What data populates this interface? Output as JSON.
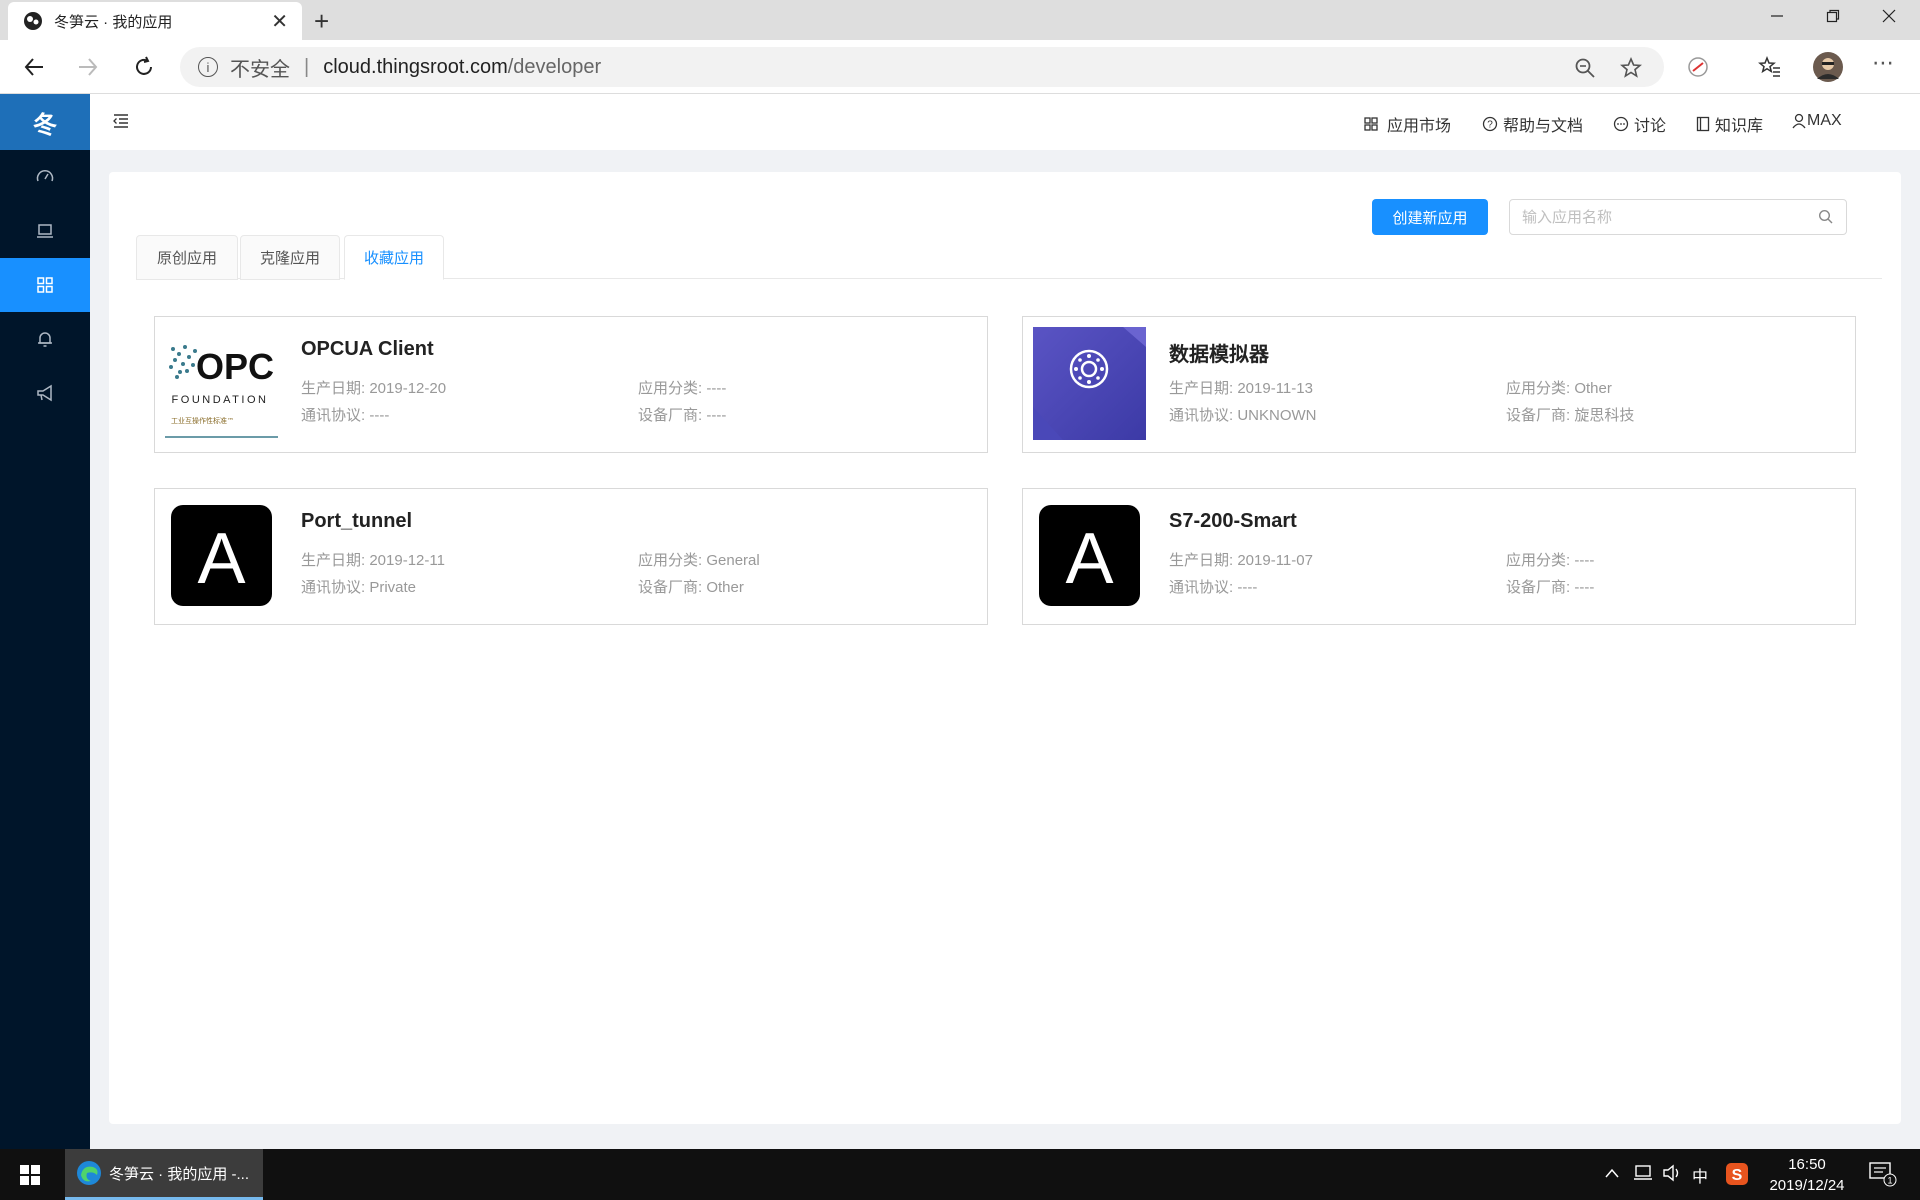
{
  "browser": {
    "tab_title": "冬笋云 · 我的应用",
    "new_tab_symbol": "+",
    "close_symbol": "✕",
    "address": {
      "security_label": "不安全",
      "separator": "|",
      "host": "cloud.thingsroot.com",
      "path": "/developer"
    }
  },
  "sidebar": {
    "logo": "冬",
    "items": [
      {
        "icon": "dashboard-icon"
      },
      {
        "icon": "laptop-icon"
      },
      {
        "icon": "appstore-icon",
        "active": true
      },
      {
        "icon": "bell-icon"
      },
      {
        "icon": "notification-icon"
      }
    ]
  },
  "header": {
    "market": "应用市场",
    "help": "帮助与文档",
    "discuss": "讨论",
    "knowledge": "知识库",
    "user": "MAX"
  },
  "toolbar": {
    "create_label": "创建新应用",
    "search_placeholder": "输入应用名称"
  },
  "tabs": [
    {
      "label": "原创应用"
    },
    {
      "label": "克隆应用"
    },
    {
      "label": "收藏应用",
      "active": true
    }
  ],
  "labels": {
    "date": "生产日期:",
    "category": "应用分类:",
    "protocol": "通讯协议:",
    "vendor": "设备厂商:"
  },
  "apps": [
    {
      "name": "OPCUA Client",
      "date": "2019-12-20",
      "category": "----",
      "protocol": "----",
      "vendor": "----",
      "icon": "opc-foundation-logo",
      "logo_text": "OPC",
      "logo_sub": "FOUNDATION",
      "logo_tagline": "工业互操作性标准™"
    },
    {
      "name": "数据模拟器",
      "date": "2019-11-13",
      "category": "Other",
      "protocol": "UNKNOWN",
      "vendor": "旋思科技",
      "icon": "simulator-icon"
    },
    {
      "name": "Port_tunnel",
      "date": "2019-12-11",
      "category": "General",
      "protocol": "Private",
      "vendor": "Other",
      "icon": "letter-a-icon",
      "letter": "A"
    },
    {
      "name": "S7-200-Smart",
      "date": "2019-11-07",
      "category": "----",
      "protocol": "----",
      "vendor": "----",
      "icon": "letter-a-icon",
      "letter": "A"
    }
  ],
  "taskbar": {
    "app_label": "冬笋云 · 我的应用 -...",
    "ime": "中",
    "time": "16:50",
    "date": "2019/12/24",
    "notification_count": "1"
  },
  "colors": {
    "primary": "#1890ff",
    "sidebar_bg": "#00152a",
    "logo_bg": "#1e6fb8"
  }
}
